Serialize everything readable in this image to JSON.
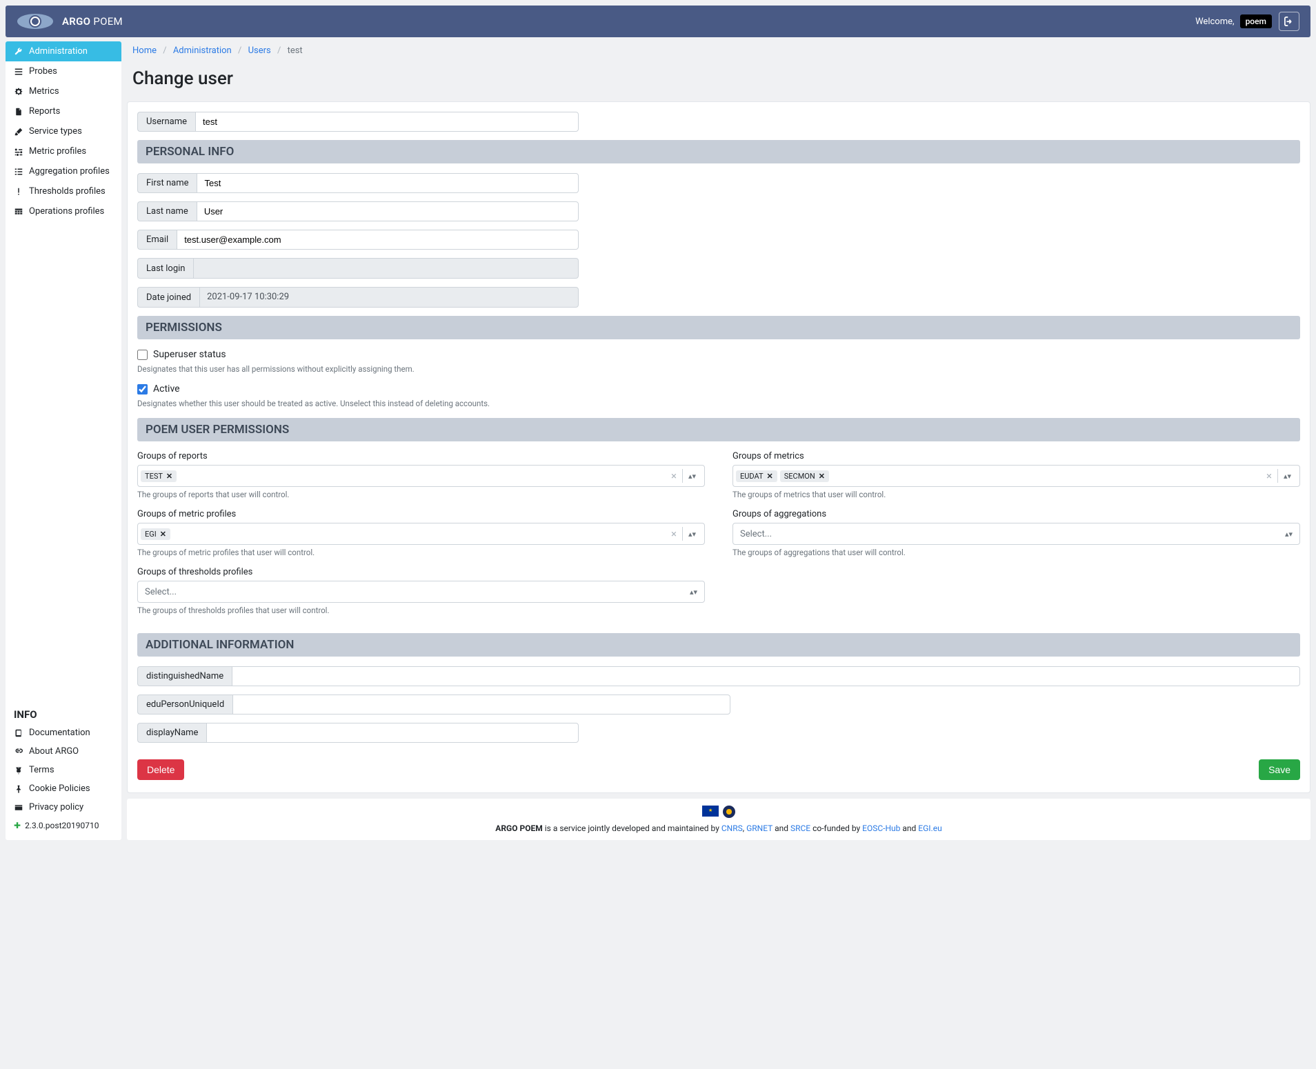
{
  "header": {
    "brand_bold": "ARGO",
    "brand_light": "POEM",
    "welcome": "Welcome,",
    "username_badge": "poem"
  },
  "sidebar": {
    "items": [
      {
        "label": "Administration",
        "icon": "wrench"
      },
      {
        "label": "Probes",
        "icon": "bars"
      },
      {
        "label": "Metrics",
        "icon": "cog"
      },
      {
        "label": "Reports",
        "icon": "file"
      },
      {
        "label": "Service types",
        "icon": "highlighter"
      },
      {
        "label": "Metric profiles",
        "icon": "sliders"
      },
      {
        "label": "Aggregation profiles",
        "icon": "list-indent"
      },
      {
        "label": "Thresholds profiles",
        "icon": "exclamation"
      },
      {
        "label": "Operations profiles",
        "icon": "table"
      }
    ],
    "info_title": "INFO",
    "info_items": [
      {
        "label": "Documentation",
        "icon": "book"
      },
      {
        "label": "About ARGO",
        "icon": "link"
      },
      {
        "label": "Terms",
        "icon": "scale"
      },
      {
        "label": "Cookie Policies",
        "icon": "thumbtack"
      },
      {
        "label": "Privacy policy",
        "icon": "card"
      }
    ],
    "version": "2.3.0.post20190710"
  },
  "breadcrumb": {
    "items": [
      "Home",
      "Administration",
      "Users",
      "test"
    ]
  },
  "page": {
    "title": "Change user"
  },
  "form": {
    "username_label": "Username",
    "username_value": "test",
    "section_personal": "PERSONAL INFO",
    "first_name_label": "First name",
    "first_name_value": "Test",
    "last_name_label": "Last name",
    "last_name_value": "User",
    "email_label": "Email",
    "email_value": "test.user@example.com",
    "last_login_label": "Last login",
    "last_login_value": "",
    "date_joined_label": "Date joined",
    "date_joined_value": "2021-09-17 10:30:29",
    "section_permissions": "PERMISSIONS",
    "superuser_label": "Superuser status",
    "superuser_help": "Designates that this user has all permissions without explicitly assigning them.",
    "active_label": "Active",
    "active_help": "Designates whether this user should be treated as active. Unselect this instead of deleting accounts.",
    "section_poem": "POEM USER PERMISSIONS",
    "groups_reports_label": "Groups of reports",
    "groups_reports_chips": [
      "TEST"
    ],
    "groups_reports_help": "The groups of reports that user will control.",
    "groups_metrics_label": "Groups of metrics",
    "groups_metrics_chips": [
      "EUDAT",
      "SECMON"
    ],
    "groups_metrics_help": "The groups of metrics that user will control.",
    "groups_mprofiles_label": "Groups of metric profiles",
    "groups_mprofiles_chips": [
      "EGI"
    ],
    "groups_mprofiles_help": "The groups of metric profiles that user will control.",
    "groups_aggregations_label": "Groups of aggregations",
    "groups_aggregations_placeholder": "Select...",
    "groups_aggregations_help": "The groups of aggregations that user will control.",
    "groups_thresholds_label": "Groups of thresholds profiles",
    "groups_thresholds_placeholder": "Select...",
    "groups_thresholds_help": "The groups of thresholds profiles that user will control.",
    "section_additional": "ADDITIONAL INFORMATION",
    "dn_label": "distinguishedName",
    "edu_label": "eduPersonUniqueId",
    "display_label": "displayName",
    "delete_btn": "Delete",
    "save_btn": "Save"
  },
  "footer": {
    "text_pre": "ARGO POEM",
    "text_mid": " is a service jointly developed and maintained by ",
    "cnrs": "CNRS",
    "grnet": "GRNET",
    "and1": " and ",
    "srce": "SRCE",
    "cofunded": " co-funded by ",
    "eosc": "EOSC-Hub",
    "and2": " and ",
    "egi": "EGI.eu",
    "comma": ", "
  }
}
